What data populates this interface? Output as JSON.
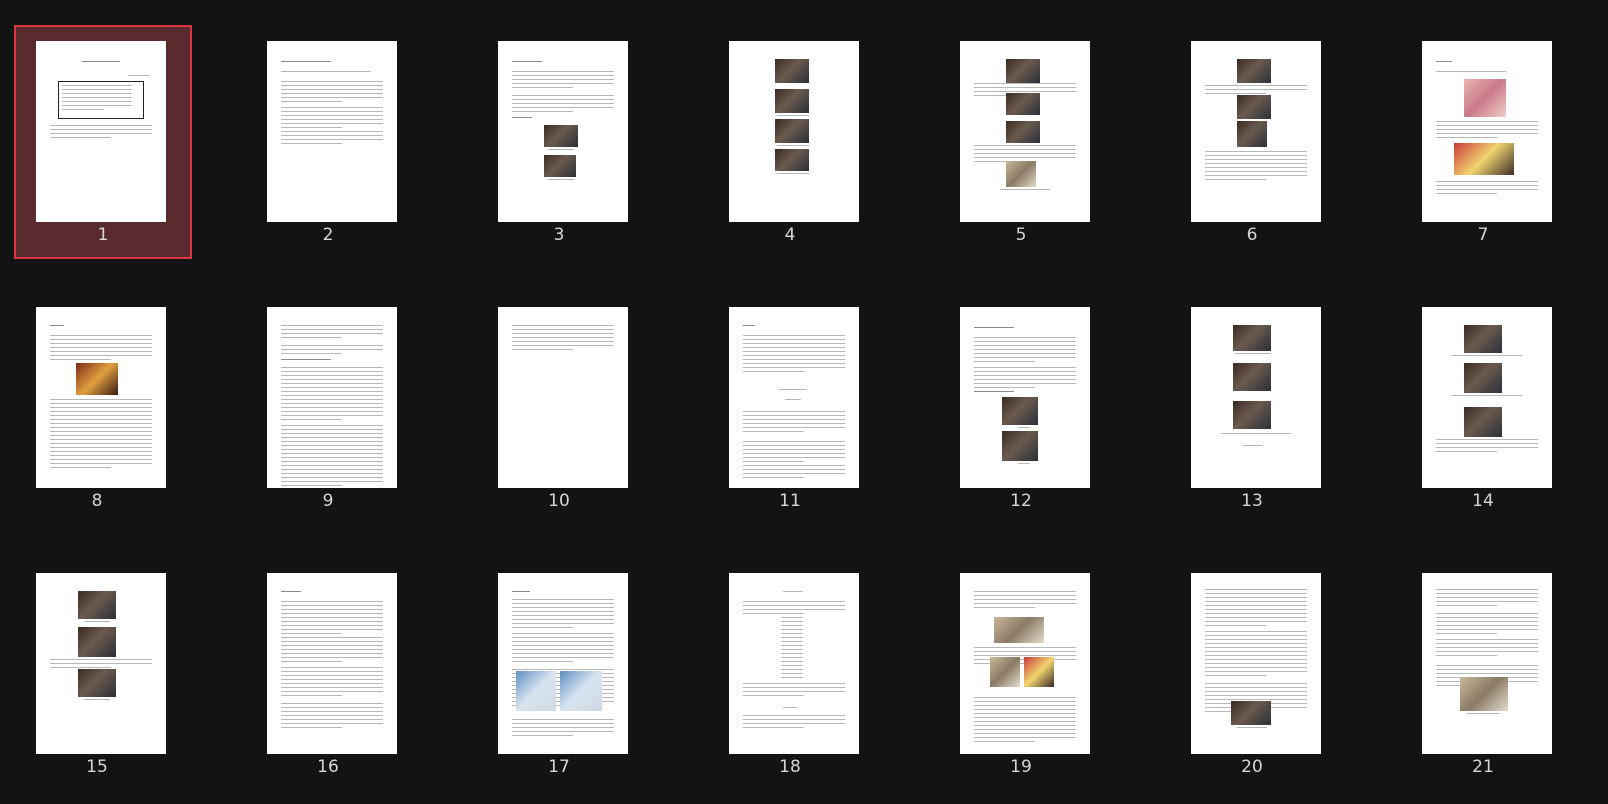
{
  "thumbnails": [
    {
      "page": "1",
      "selected": true
    },
    {
      "page": "2",
      "selected": false
    },
    {
      "page": "3",
      "selected": false
    },
    {
      "page": "4",
      "selected": false
    },
    {
      "page": "5",
      "selected": false
    },
    {
      "page": "6",
      "selected": false
    },
    {
      "page": "7",
      "selected": false
    },
    {
      "page": "8",
      "selected": false
    },
    {
      "page": "9",
      "selected": false
    },
    {
      "page": "10",
      "selected": false
    },
    {
      "page": "11",
      "selected": false
    },
    {
      "page": "12",
      "selected": false
    },
    {
      "page": "13",
      "selected": false
    },
    {
      "page": "14",
      "selected": false
    },
    {
      "page": "15",
      "selected": false
    },
    {
      "page": "16",
      "selected": false
    },
    {
      "page": "17",
      "selected": false
    },
    {
      "page": "18",
      "selected": false
    },
    {
      "page": "19",
      "selected": false
    },
    {
      "page": "20",
      "selected": false
    },
    {
      "page": "21",
      "selected": false
    }
  ],
  "colors": {
    "background": "#131316",
    "selection_fill": "#5a2b2e",
    "selection_border": "#d9363e",
    "page_number_text": "#d6d6d6"
  }
}
